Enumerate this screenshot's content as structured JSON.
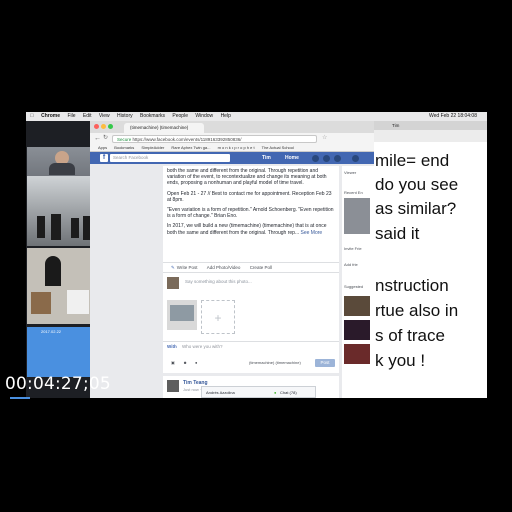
{
  "menubar": {
    "apple": "",
    "items": [
      "Chrome",
      "File",
      "Edit",
      "View",
      "History",
      "Bookmarks",
      "People",
      "Window",
      "Help"
    ],
    "clock": "Wed Feb 22 18:04:08"
  },
  "video_call": {
    "current_caption": "Current Call",
    "tile4_caption": "2017.02.22"
  },
  "browser": {
    "tab_title": "(timemachine) (timemachine)",
    "secure_label": "Secure",
    "url": "https://www.facebook.com/events/1189163392850836/",
    "bookmarks": [
      "Apps",
      "Bookmarks",
      "SimpleAdder",
      "Rare Aphex Twin ga...",
      "m o n k • p r o p h e t",
      "The Actual School"
    ]
  },
  "facebook": {
    "search_placeholder": "Search Facebook",
    "user": "Tim",
    "home": "Home",
    "description": [
      "both the same and different from the original. Through repetition and variation of the event, to recontextualize and change its meaning at both ends, proposing a nonhuman and playful model of time travel.",
      "Open Feb 21 - 27 // Best to contact me for appointment. Reception Feb 23 at 8pm.",
      "\"Even variation is a form of repetition.\" Arnold Schoenberg. \"Even repetition is a form of change.\" Brian Eno.",
      "In 2017, we will build a new (timemachine) (timemachine) that is at once both the same and different from the original. Through rep..."
    ],
    "see_more": "See More",
    "composer": {
      "tabs": [
        "Write Post",
        "Add Photo/Video",
        "Create Poll"
      ],
      "placeholder": "Say something about this photo...",
      "with_label": "With",
      "with_placeholder": "Who were you with?",
      "audience": "(timemachine) (timemachine)",
      "post_button": "Post"
    },
    "post": {
      "author": "Tim Teang",
      "date": "Just now · 11"
    },
    "chat": {
      "friend": "Andrés Azzolina",
      "chat_label": "Chat (78)"
    },
    "sidebar": {
      "labels": [
        "Viewer",
        "Recent En",
        "Invite Frie",
        "Add frie",
        "Suggested"
      ]
    }
  },
  "whiteboard": {
    "title": "Tim",
    "lines": [
      "mile= end",
      "do you see",
      "as similar?",
      "said it",
      "",
      "nstruction",
      "rtue also in",
      "s of trace",
      "k you !"
    ]
  },
  "timecode": "00:04:27;05"
}
